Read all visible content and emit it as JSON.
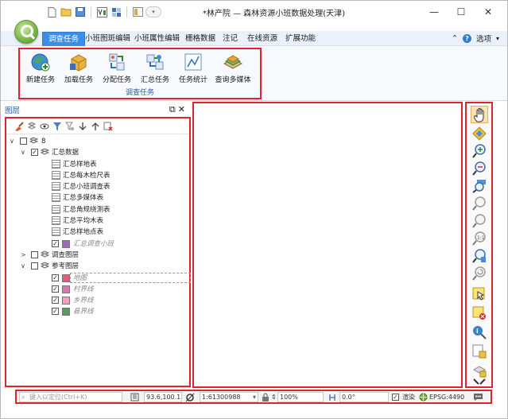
{
  "window": {
    "title": "*林产院 — 森林资源小班数据处理(天津)",
    "controls": {
      "minimize": "—",
      "maximize": "☐",
      "close": "✕"
    }
  },
  "menu": {
    "tabs": [
      {
        "label": "调查任务",
        "active": true
      },
      {
        "label": "小班图斑编辑"
      },
      {
        "label": "小班属性编辑"
      },
      {
        "label": "栅格数据"
      },
      {
        "label": "注记"
      },
      {
        "label": "在线资源"
      },
      {
        "label": "扩展功能"
      }
    ],
    "right": {
      "collapse": "⌃",
      "help": "?",
      "options": "选项"
    }
  },
  "ribbon": {
    "group_label": "调查任务",
    "buttons": [
      {
        "label": "新建任务",
        "icon": "new-task-icon"
      },
      {
        "label": "加载任务",
        "icon": "load-task-icon"
      },
      {
        "label": "分配任务",
        "icon": "assign-task-icon"
      },
      {
        "label": "汇总任务",
        "icon": "summary-task-icon"
      },
      {
        "label": "任务统计",
        "icon": "task-stats-icon"
      },
      {
        "label": "查询多媒体",
        "icon": "query-media-icon"
      }
    ]
  },
  "layers": {
    "title": "图层",
    "controls": {
      "float": "⧉",
      "close": "✕"
    },
    "tree": [
      {
        "level": 0,
        "expand": "∨",
        "checked": false,
        "icon": "layer-group",
        "label": "8"
      },
      {
        "level": 1,
        "expand": "∨",
        "checked": true,
        "icon": "layer-group",
        "label": "汇总数据"
      },
      {
        "level": 2,
        "icon": "table",
        "label": "汇总样地表"
      },
      {
        "level": 2,
        "icon": "table",
        "label": "汇总每木检尺表"
      },
      {
        "level": 2,
        "icon": "table",
        "label": "汇总小班调查表"
      },
      {
        "level": 2,
        "icon": "table",
        "label": "汇总多媒体表"
      },
      {
        "level": 2,
        "icon": "table",
        "label": "汇总角规绕测表"
      },
      {
        "level": 2,
        "icon": "table",
        "label": "汇总平均木表"
      },
      {
        "level": 2,
        "icon": "table",
        "label": "汇总样地点表"
      },
      {
        "level": 2,
        "checked": true,
        "swatch": "#9b6bb8",
        "label": "汇总调查小班",
        "italic": true
      },
      {
        "level": 1,
        "expand": ">",
        "checked": false,
        "icon": "layer-group",
        "label": "调查图层"
      },
      {
        "level": 1,
        "expand": "∨",
        "checked": false,
        "icon": "layer-group",
        "label": "参考图层"
      },
      {
        "level": 2,
        "checked": true,
        "swatch": "#e35b7a",
        "label": "地图",
        "italic": true,
        "selected": true
      },
      {
        "level": 2,
        "checked": true,
        "swatch": "#d97ba8",
        "label": "村界线",
        "italic": true
      },
      {
        "level": 2,
        "checked": true,
        "swatch": "#f2a3b3",
        "label": "乡界线",
        "italic": true
      },
      {
        "level": 2,
        "checked": true,
        "swatch": "#5a9a5a",
        "label": "县界线",
        "italic": true
      }
    ]
  },
  "right_toolbar": [
    "hand-pan-icon",
    "full-extent-icon",
    "zoom-in-icon",
    "zoom-out-icon",
    "zoom-to-layer-icon",
    "zoom-previous-icon",
    "zoom-next-icon",
    "zoom-1to1-icon",
    "zoom-selection-icon",
    "refresh-map-icon",
    "select-feature-icon",
    "clear-selection-icon",
    "identify-icon",
    "measure-icon",
    "bookmark-icon",
    "fullscreen-icon"
  ],
  "statusbar": {
    "search_placeholder": "键入以定位(Ctrl+K)",
    "coords": "93.6,100.1",
    "scale": "1:61300988",
    "magnifier": "100%",
    "rotation": "0.0°",
    "render_label": "渲染",
    "render_checked": true,
    "crs": "EPSG:4490"
  }
}
